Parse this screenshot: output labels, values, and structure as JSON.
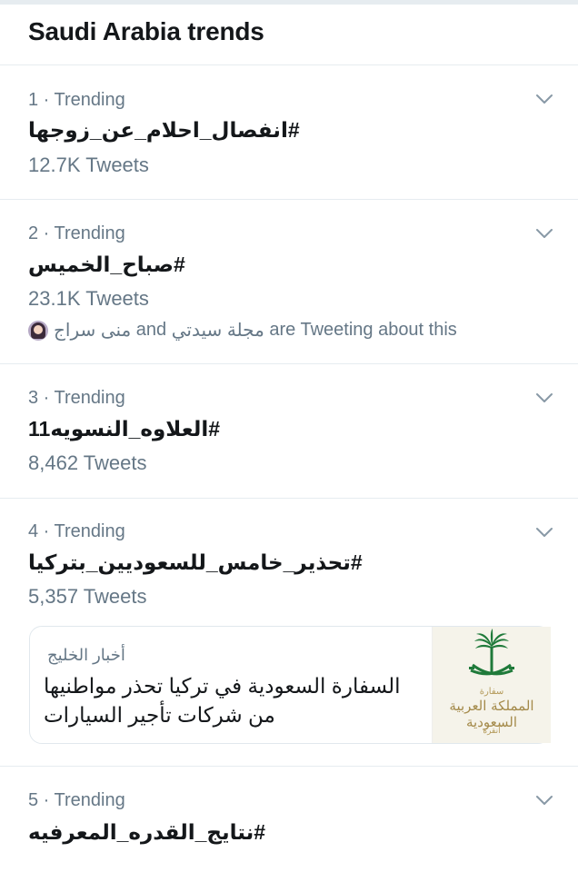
{
  "header": {
    "title": "Saudi Arabia trends"
  },
  "trends": [
    {
      "rank_label": "1 · Trending",
      "name": "#انفصال_احلام_عن_زوجها",
      "count": "12.7K Tweets"
    },
    {
      "rank_label": "2 · Trending",
      "name": "#صباح_الخميس",
      "count": "23.1K Tweets",
      "tweeting": {
        "user1": "منى سراج",
        "and": "and",
        "user2": "مجلة سيدتي",
        "suffix": "are Tweeting about this"
      }
    },
    {
      "rank_label": "3 · Trending",
      "name": "#العلاوه_النسويه11",
      "count": "8,462 Tweets"
    },
    {
      "rank_label": "4 · Trending",
      "name": "#تحذير_خامس_للسعوديين_بتركيا",
      "count": "5,357 Tweets",
      "news": {
        "source": "أخبار الخليج",
        "headline_line1": "السفارة السعودية في تركيا تحذر مواطنيها",
        "headline_line2": "من شركات تأجير السيارات",
        "thumbnail": {
          "caption_top": "سفارة",
          "caption_main": "المملكة العربية السعودية",
          "caption_bottom": "أنقرة",
          "icon": "saudi-emblem-palm-swords"
        }
      }
    },
    {
      "rank_label": "5 · Trending",
      "name": "#نتايج_القدره_المعرفيه"
    }
  ],
  "colors": {
    "text_primary": "#14171a",
    "text_secondary": "#657786",
    "divider": "#e6ecf0",
    "emblem_green": "#1f7a3a",
    "emblem_gold": "#b49a5a"
  }
}
